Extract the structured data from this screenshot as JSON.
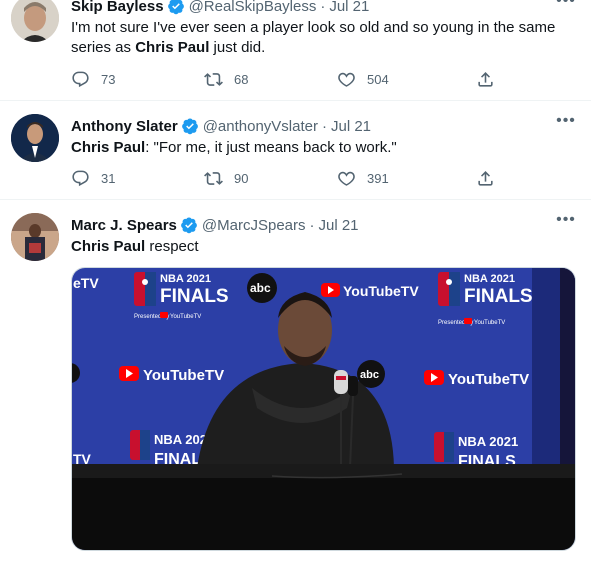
{
  "tweets": [
    {
      "name": "Skip Bayless",
      "handle": "@RealSkipBayless",
      "separator": "·",
      "date": "Jul 21",
      "text_parts": [
        "I'm not sure I've ever seen a player look so old and so young in the same series as ",
        "Chris Paul",
        " just did."
      ],
      "replies": "73",
      "retweets": "68",
      "likes": "504"
    },
    {
      "name": "Anthony Slater",
      "handle": "@anthonyVslater",
      "separator": "·",
      "date": "Jul 21",
      "text_parts": [
        "Chris Paul",
        ": \"For me, it just means back to work.\""
      ],
      "replies": "31",
      "retweets": "90",
      "likes": "391"
    },
    {
      "name": "Marc J. Spears",
      "handle": "@MarcJSpears",
      "separator": "·",
      "date": "Jul 21",
      "text_parts": [
        "Chris Paul",
        " respect"
      ]
    }
  ],
  "backdrop": {
    "sponsor": "YouTubeTV",
    "network": "abc",
    "event_top": "NBA 2021",
    "event_bottom": "FINALS",
    "presented_by": "Presented by",
    "partial_left": "eTV",
    "partial_bottom": "TV"
  },
  "colors": {
    "verified": "#1d9bf0",
    "backdrop": "#2c3fa6",
    "icon_gray": "#536471",
    "youtube_red": "#ff0000"
  }
}
